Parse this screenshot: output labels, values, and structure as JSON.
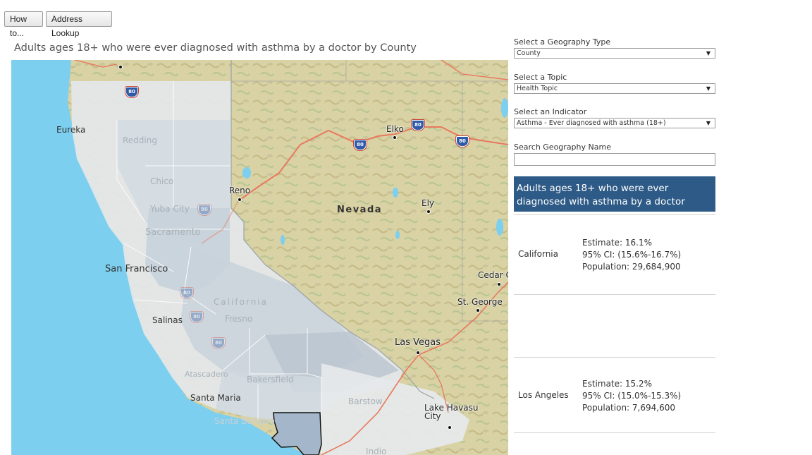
{
  "toolbar": {
    "howto_label": "How to...",
    "address_label": "Address Lookup"
  },
  "map": {
    "title": "Adults ages 18+ who were ever diagnosed with asthma by a doctor by County",
    "state_labels": {
      "nevada": "Nevada",
      "california": "California"
    },
    "cities": {
      "eureka": "Eureka",
      "redding": "Redding",
      "chico": "Chico",
      "yuba_city": "Yuba City",
      "sacramento": "Sacramento",
      "san_francisco": "San Francisco",
      "salinas": "Salinas",
      "fresno": "Fresno",
      "atascadero": "Atascadero",
      "bakersfield": "Bakersfield",
      "santa_maria": "Santa Maria",
      "santa_barbara": "Santa Barbara",
      "barstow": "Barstow",
      "indio": "Indio",
      "reno": "Reno",
      "elko": "Elko",
      "ely": "Ely",
      "cedar_city": "Cedar C",
      "st_george": "St. George",
      "las_vegas": "Las Vegas",
      "lake_havasu": "Lake Havasu City"
    },
    "highway": "80",
    "colors": {
      "ocean": "#7ccfef",
      "land": "#d9d3a6",
      "county_fill": "#aebdcc",
      "county_highlight": "#a3b6ca",
      "interstate": "#e8795f"
    }
  },
  "panel": {
    "geo_type_label": "Select a Geography Type",
    "geo_type_value": "County",
    "topic_label": "Select a Topic",
    "topic_value": "Health Topic",
    "indicator_label": "Select an Indicator",
    "indicator_value": "Asthma - Ever diagnosed with asthma (18+)",
    "search_label": "Search Geography Name",
    "search_value": "",
    "header": "Adults ages 18+ who were ever diagnosed with asthma by a doctor",
    "header_color": "#2d5a86",
    "results": [
      {
        "name": "California",
        "estimate": "Estimate: 16.1%",
        "ci": "95% CI: (15.6%-16.7%)",
        "population": "Population: 29,684,900"
      },
      {
        "name": "Los Angeles",
        "estimate": "Estimate: 15.2%",
        "ci": "95% CI: (15.0%-15.3%)",
        "population": "Population: 7,694,600"
      }
    ]
  }
}
